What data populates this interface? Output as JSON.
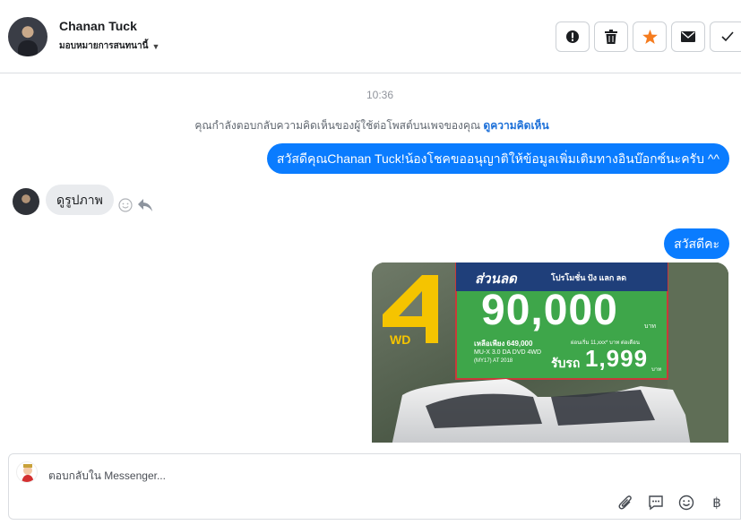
{
  "header": {
    "contact_name": "Chanan Tuck",
    "assignee_label": "มอบหมายการสนทนานี้",
    "actions": [
      {
        "name": "spam-button",
        "icon": "alert-icon"
      },
      {
        "name": "delete-button",
        "icon": "trash-icon"
      },
      {
        "name": "star-button",
        "icon": "star-icon",
        "color": "#f57c1f"
      },
      {
        "name": "mark-unread-button",
        "icon": "envelope-icon"
      },
      {
        "name": "mark-done-button",
        "icon": "check-icon"
      }
    ]
  },
  "thread": {
    "timestamp": "10:36",
    "context_text": "คุณกำลังตอบกลับความคิดเห็นของผู้ใช้ต่อโพสต์บนเพจของคุณ",
    "context_link": "ดูความคิดเห็น",
    "messages": [
      {
        "from": "page",
        "text": "สวัสดีคุณChanan Tuck!น้องโชคขออนุญาติให้ข้อมูลเพิ่มเติมทางอินบ๊อกซ์นะครับ ^^"
      },
      {
        "from": "user",
        "text": "ดูรูปภาพ"
      },
      {
        "from": "page",
        "text": "สวัสดีคะ"
      }
    ],
    "image_ad": {
      "badge_number": "4",
      "badge_suffix": "WD",
      "headline": "ส่วนลด",
      "promo_line": "โปรโมชั่น ปัง แลก ลด",
      "discount": "90,000",
      "discount_unit": "บาท",
      "price_label": "เหลือเพียง 649,000",
      "monthly_label": "ผ่อนเริ่ม 11,xxx* บาท ต่อเดือน",
      "model": "MU-X 3.0 DA DVD 4WD",
      "model_year": "(MY17) AT 2018",
      "pickup_label": "รับรถ",
      "pickup_price": "1,999",
      "pickup_unit": "บาท"
    }
  },
  "composer": {
    "placeholder": "ตอบกลับใน Messenger..."
  },
  "colors": {
    "outgoing_bubble": "#0a7cff",
    "incoming_bubble": "#e9ebee",
    "link": "#1b6fd8",
    "star": "#f57c1f"
  }
}
